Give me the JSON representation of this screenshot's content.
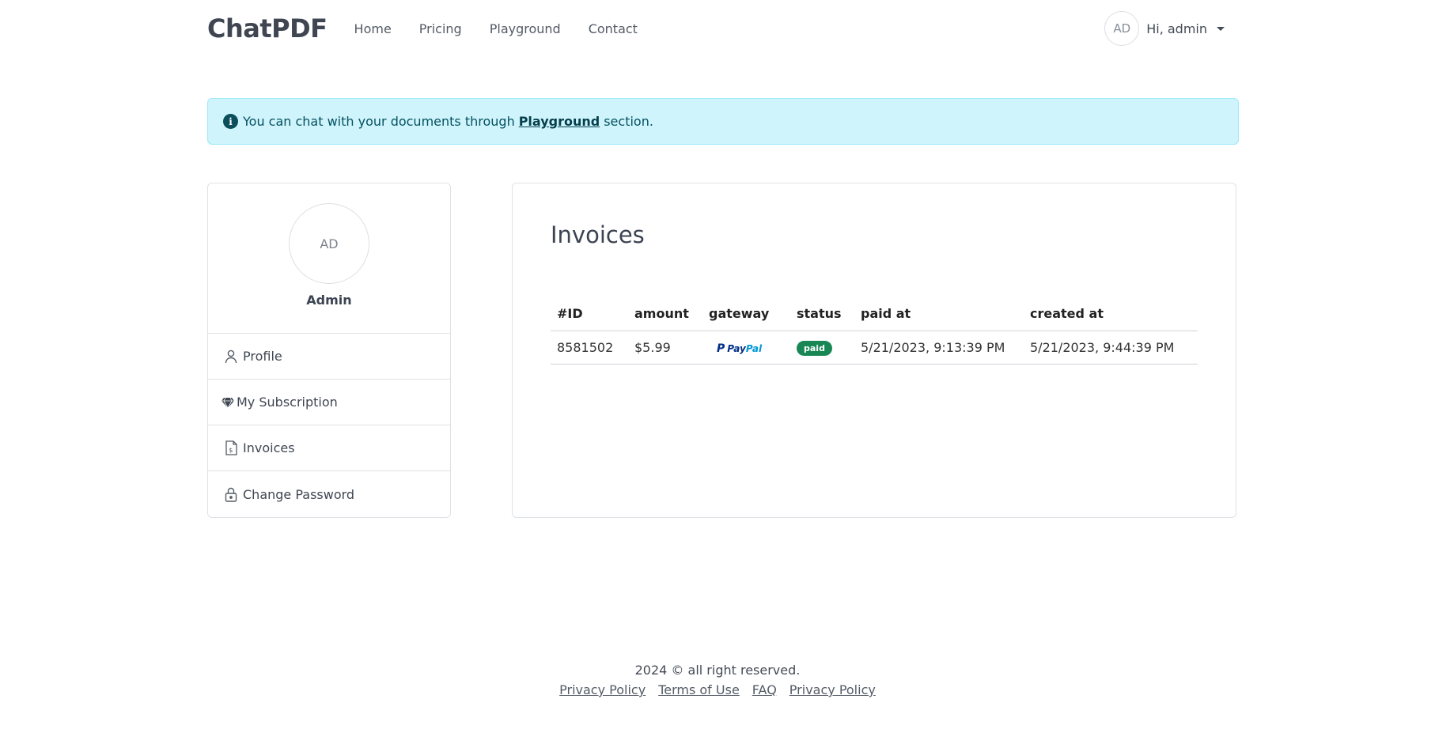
{
  "header": {
    "brand": "ChatPDF",
    "nav": [
      "Home",
      "Pricing",
      "Playground",
      "Contact"
    ],
    "user_initials": "AD",
    "user_greeting": "Hi, admin"
  },
  "alert": {
    "text_before": "You can chat with your documents through",
    "link": "Playground",
    "text_after": "section."
  },
  "sidebar": {
    "avatar_initials": "AD",
    "name": "Admin",
    "items": [
      {
        "label": "Profile",
        "icon": "person-icon"
      },
      {
        "label": "My Subscription",
        "icon": "gem-icon"
      },
      {
        "label": "Invoices",
        "icon": "invoice-icon"
      },
      {
        "label": "Change Password",
        "icon": "lock-icon"
      }
    ]
  },
  "invoices": {
    "title": "Invoices",
    "columns": [
      "#ID",
      "amount",
      "gateway",
      "status",
      "paid at",
      "created at"
    ],
    "rows": [
      {
        "id": "8581502",
        "amount": "$5.99",
        "gateway": "PayPal",
        "status": "paid",
        "paid_at": "5/21/2023, 9:13:39 PM",
        "created_at": "5/21/2023, 9:44:39 PM"
      }
    ]
  },
  "footer": {
    "copyright": "2024 © all right reserved.",
    "links": [
      "Privacy Policy",
      "Terms of Use",
      "FAQ",
      "Privacy Policy"
    ]
  }
}
